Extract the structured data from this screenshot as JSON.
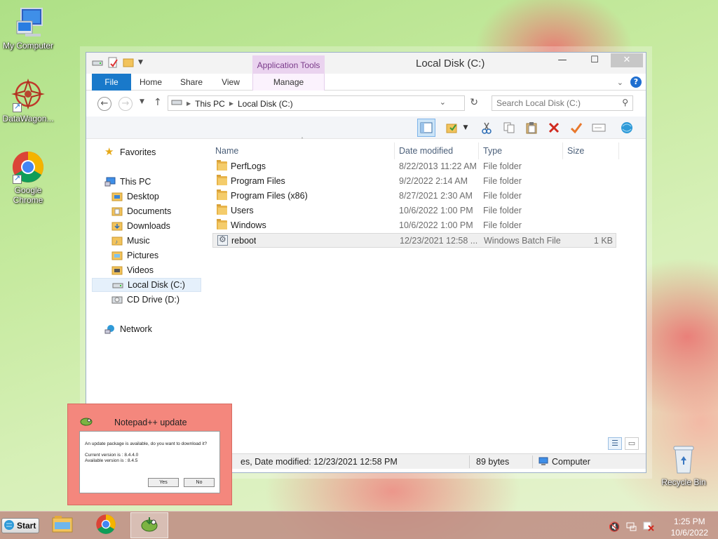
{
  "desktop": {
    "icons": [
      {
        "label": "My Computer",
        "icon": "computer-icon"
      },
      {
        "label": "DataWagon...",
        "icon": "datawagon-icon"
      },
      {
        "label": "Google Chrome",
        "icon": "chrome-icon"
      },
      {
        "label": "Recycle Bin",
        "icon": "recycle-bin-icon"
      }
    ]
  },
  "explorer": {
    "title": "Local Disk (C:)",
    "context_tab_header": "Application Tools",
    "ribbon_tabs": [
      "File",
      "Home",
      "Share",
      "View",
      "Manage"
    ],
    "address": {
      "crumbs": [
        "This PC",
        "Local Disk (C:)"
      ]
    },
    "search": {
      "placeholder": "Search Local Disk (C:)"
    },
    "nav_pane": {
      "favorites": "Favorites",
      "this_pc": "This PC",
      "children": [
        "Desktop",
        "Documents",
        "Downloads",
        "Music",
        "Pictures",
        "Videos",
        "Local Disk (C:)",
        "CD Drive (D:)"
      ],
      "network": "Network",
      "selected": "Local Disk (C:)"
    },
    "columns": [
      "Name",
      "Date modified",
      "Type",
      "Size"
    ],
    "files": [
      {
        "name": "PerfLogs",
        "date": "8/22/2013 11:22 AM",
        "type": "File folder",
        "size": "",
        "kind": "folder"
      },
      {
        "name": "Program Files",
        "date": "9/2/2022 2:14 AM",
        "type": "File folder",
        "size": "",
        "kind": "folder"
      },
      {
        "name": "Program Files (x86)",
        "date": "8/27/2021 2:30 AM",
        "type": "File folder",
        "size": "",
        "kind": "folder"
      },
      {
        "name": "Users",
        "date": "10/6/2022 1:00 PM",
        "type": "File folder",
        "size": "",
        "kind": "folder"
      },
      {
        "name": "Windows",
        "date": "10/6/2022 1:00 PM",
        "type": "File folder",
        "size": "",
        "kind": "folder"
      },
      {
        "name": "reboot",
        "date": "12/23/2021 12:58 ...",
        "type": "Windows Batch File",
        "size": "1 KB",
        "kind": "batch"
      }
    ],
    "status": {
      "details": "es, Date modified: 12/23/2021 12:58 PM",
      "size": "89 bytes",
      "location": "Computer"
    }
  },
  "npp_dialog": {
    "title": "Notepad++ update",
    "message": "An update package is available, do you want to download it?",
    "current_version": "Current version is  :  8.4.4.0",
    "available_version": "Available version is :  8.4.5",
    "yes_label": "Yes",
    "no_label": "No"
  },
  "taskbar": {
    "start_label": "Start",
    "time": "1:25 PM",
    "date": "10/6/2022"
  }
}
